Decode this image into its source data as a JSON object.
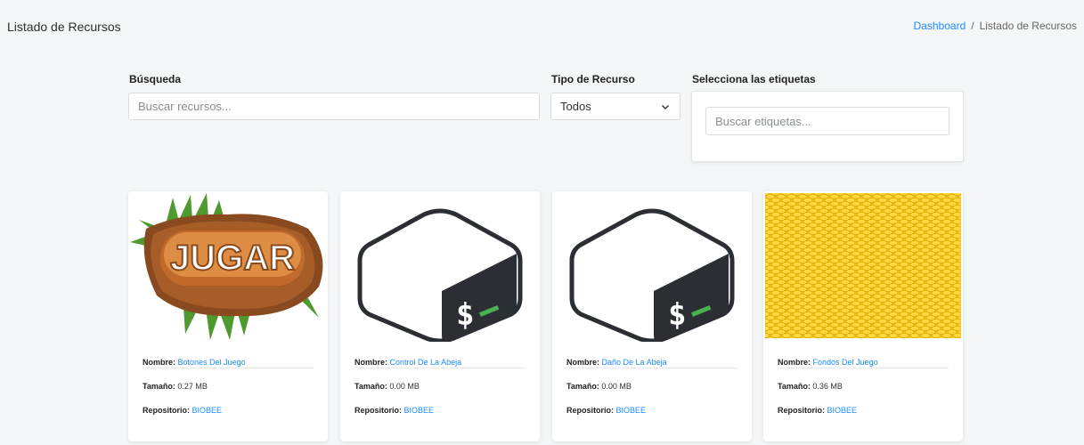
{
  "header": {
    "title": "Listado de Recursos",
    "breadcrumb": {
      "link": "Dashboard",
      "separator": "/",
      "current": "Listado de Recursos"
    }
  },
  "filters": {
    "search": {
      "label": "Búsqueda",
      "placeholder": "Buscar recursos..."
    },
    "type": {
      "label": "Tipo de Recurso",
      "selected": "Todos"
    },
    "tags": {
      "label": "Selecciona las etiquetas",
      "placeholder": "Buscar etiquetas..."
    }
  },
  "cards": [
    {
      "thumbnail_icon": "jugar-button-image",
      "thumbnail_text": "JUGAR",
      "name_label": "Nombre:",
      "name": "Botones Del Juego",
      "size_label": "Tamaño:",
      "size": "0.27 MB",
      "repo_label": "Repositorio:",
      "repo": "BIOBEE"
    },
    {
      "thumbnail_icon": "bash-terminal-icon",
      "name_label": "Nombre:",
      "name": "Control De La Abeja",
      "size_label": "Tamaño:",
      "size": "0.00 MB",
      "repo_label": "Repositorio:",
      "repo": "BIOBEE"
    },
    {
      "thumbnail_icon": "bash-terminal-icon",
      "name_label": "Nombre:",
      "name": "Daño De La Abeja",
      "size_label": "Tamaño:",
      "size": "0.00 MB",
      "repo_label": "Repositorio:",
      "repo": "BIOBEE"
    },
    {
      "thumbnail_icon": "honeycomb-pattern-image",
      "name_label": "Nombre:",
      "name": "Fondos Del Juego",
      "size_label": "Tamaño:",
      "size": "0.36 MB",
      "repo_label": "Repositorio:",
      "repo": "BIOBEE"
    }
  ],
  "colors": {
    "link": "#1a8cff",
    "background": "#f5f6f7",
    "honey": "#f5c518"
  }
}
